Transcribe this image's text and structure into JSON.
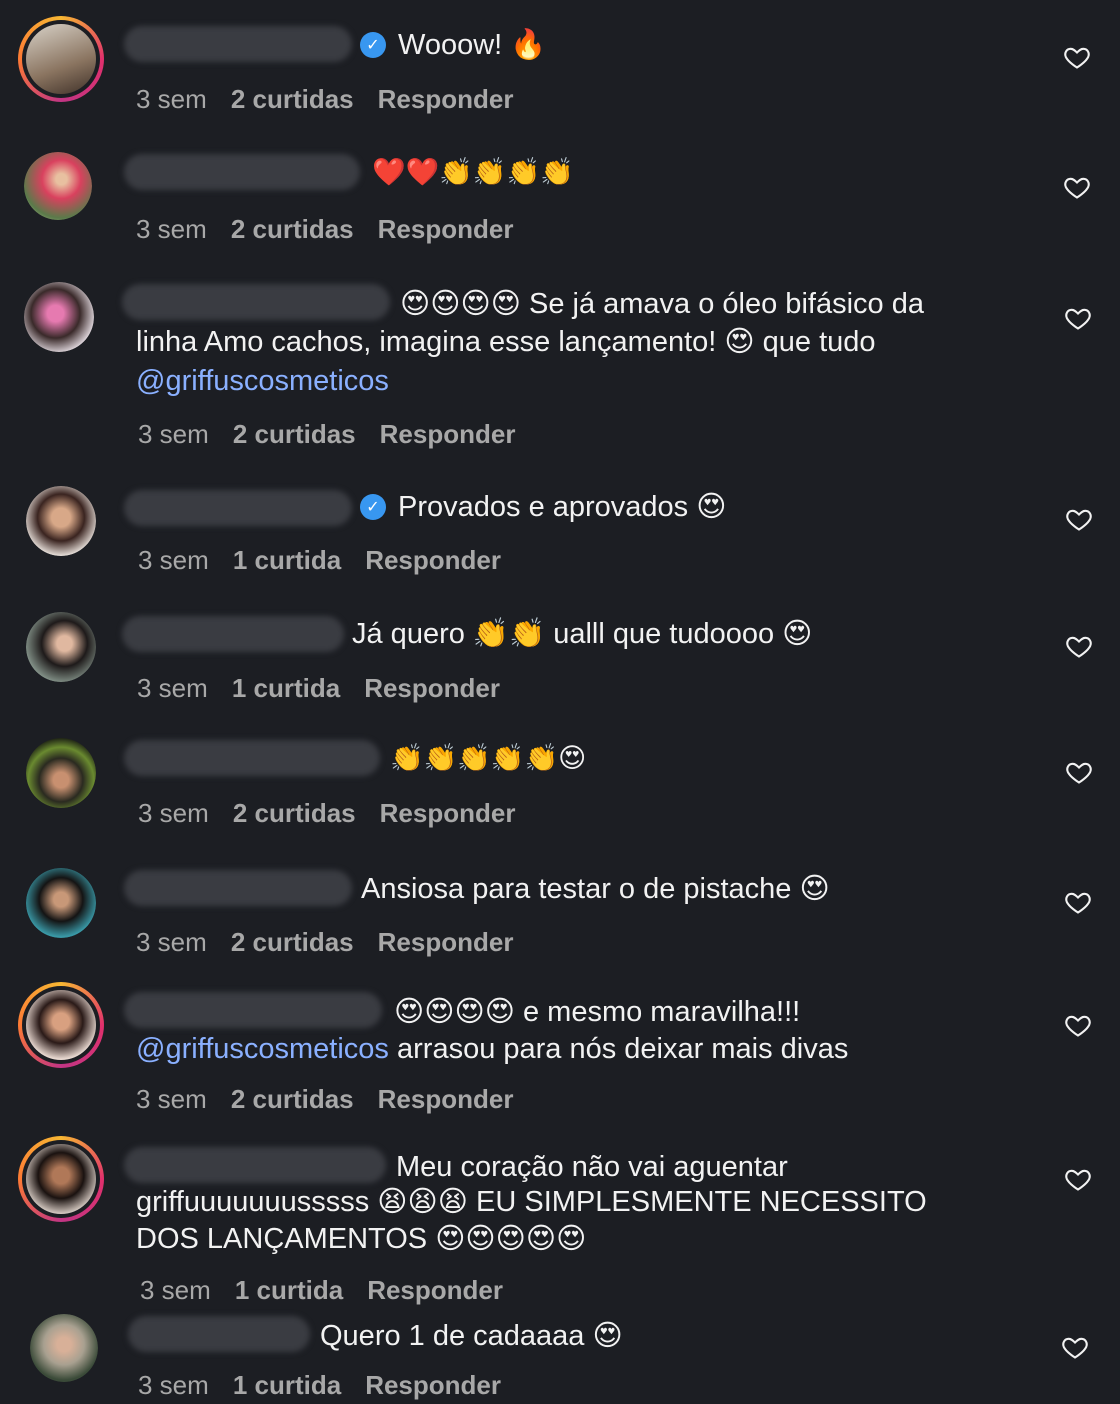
{
  "colors": {
    "background": "#1c1e23",
    "text": "#f2f2f2",
    "meta": "#a8a8a8",
    "mention": "#8ab0ff",
    "verified": "#3897f0"
  },
  "icons": {
    "like": "heart-outline-icon",
    "verified": "verified-badge-icon"
  },
  "comments": [
    {
      "text": "Wooow! 🔥",
      "time": "3 sem",
      "likes": "2 curtidas",
      "reply": "Responder"
    },
    {
      "text": "❤️❤️👏👏👏👏",
      "time": "3 sem",
      "likes": "2 curtidas",
      "reply": "Responder"
    },
    {
      "line1": "😍😍😍😍 Se já amava o óleo bifásico da",
      "line2": "linha Amo cachos, imagina esse lançamento! 😍 que tudo",
      "mention": "@griffuscosmeticos",
      "time": "3 sem",
      "likes": "2 curtidas",
      "reply": "Responder"
    },
    {
      "text": "Provados e aprovados 😍",
      "time": "3 sem",
      "likes": "1 curtida",
      "reply": "Responder"
    },
    {
      "text": "Já quero 👏👏 ualll que tudoooo 😍",
      "time": "3 sem",
      "likes": "1 curtida",
      "reply": "Responder"
    },
    {
      "text": "👏👏👏👏👏😍",
      "time": "3 sem",
      "likes": "2 curtidas",
      "reply": "Responder"
    },
    {
      "text": "Ansiosa para testar o de pistache 😍",
      "time": "3 sem",
      "likes": "2 curtidas",
      "reply": "Responder"
    },
    {
      "line1": "😍😍😍😍 e mesmo maravilha!!!",
      "mention": "@griffuscosmeticos",
      "line2_rest": " arrasou para nós deixar mais divas",
      "time": "3 sem",
      "likes": "2 curtidas",
      "reply": "Responder"
    },
    {
      "line1": "Meu coração não vai aguentar",
      "line2": "griffuuuuuuusssss 😫😫😫 EU SIMPLESMENTE NECESSITO",
      "line3": "DOS LANÇAMENTOS 😍😍😍😍😍",
      "time": "3 sem",
      "likes": "1 curtida",
      "reply": "Responder"
    },
    {
      "text": "Quero 1 de cadaaaa 😍",
      "time": "3 sem",
      "likes": "1 curtida",
      "reply": "Responder"
    }
  ]
}
